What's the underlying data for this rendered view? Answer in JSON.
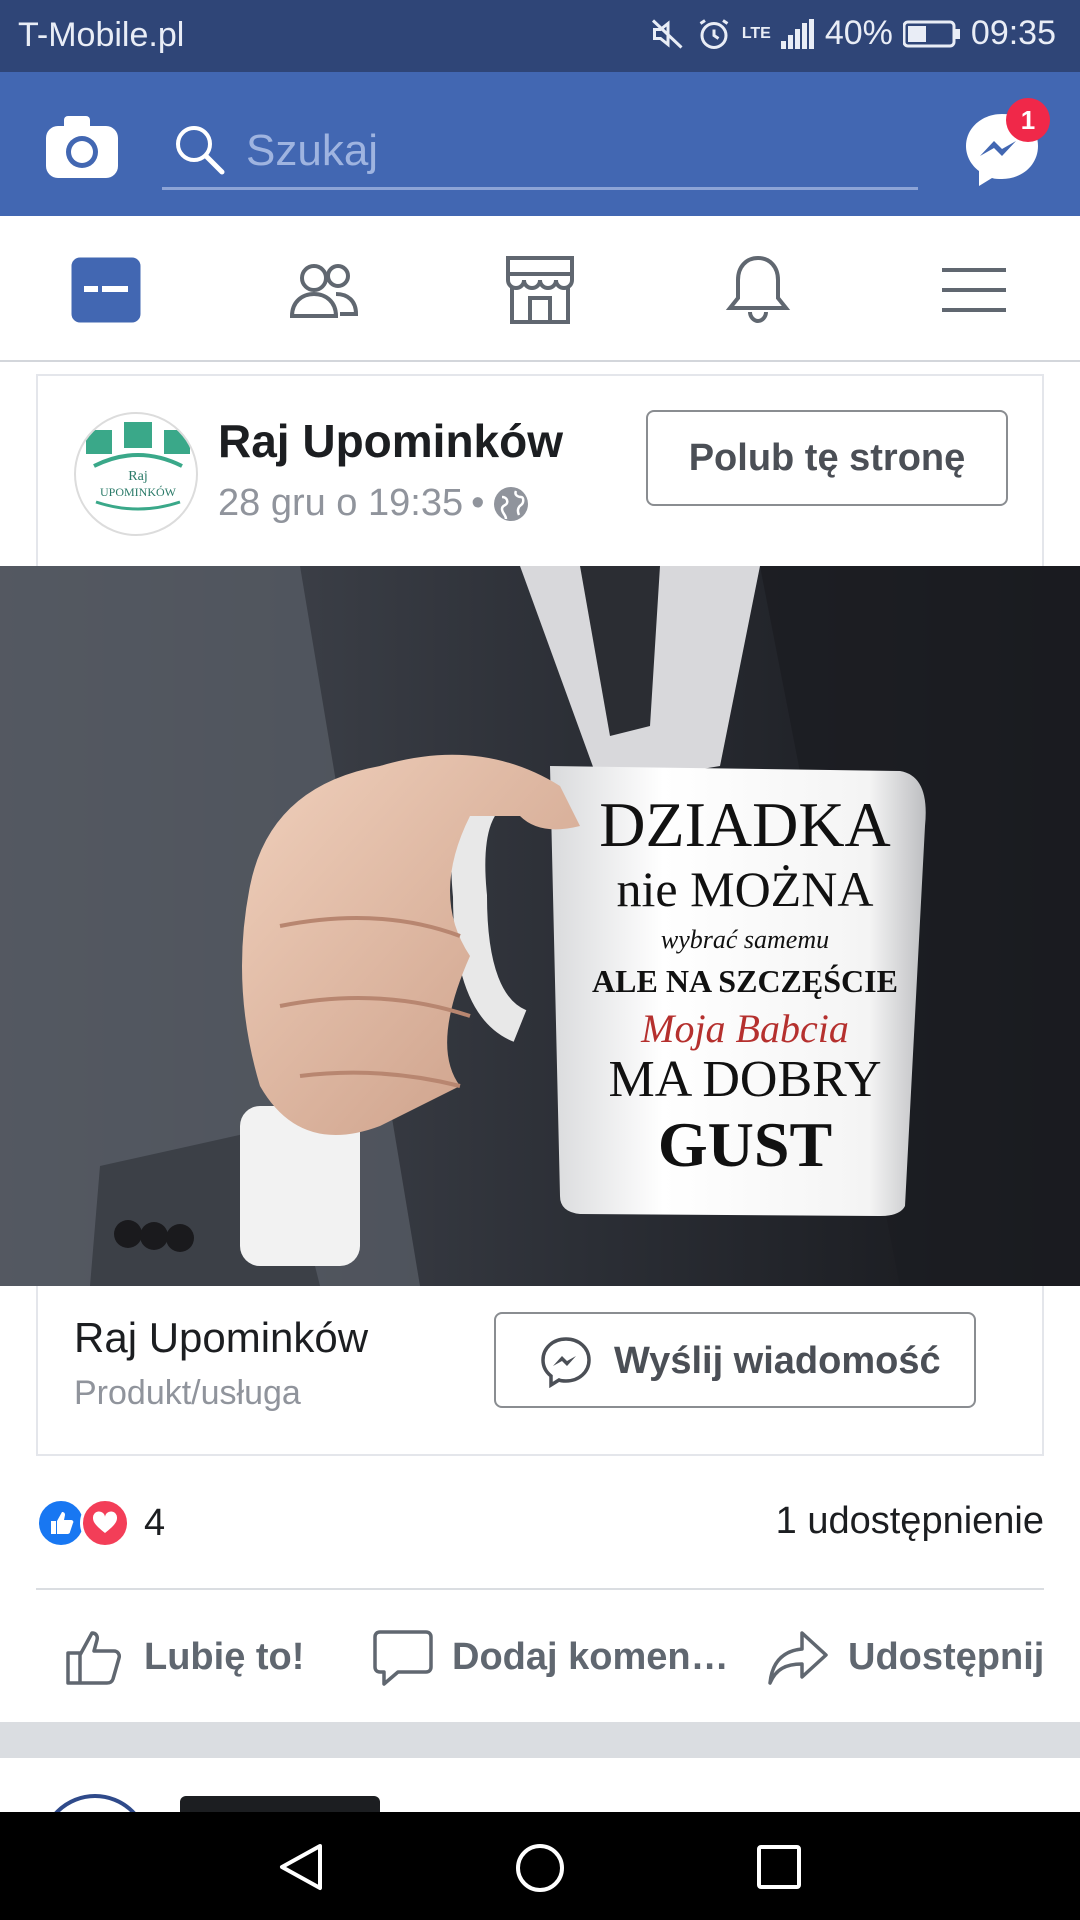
{
  "status_bar": {
    "carrier": "T-Mobile.pl",
    "network": "LTE",
    "battery": "40%",
    "time": "09:35"
  },
  "header": {
    "search_placeholder": "Szukaj",
    "messenger_badge": "1"
  },
  "tabs": [
    "news-feed",
    "friends",
    "marketplace",
    "notifications",
    "menu"
  ],
  "post": {
    "page_name": "Raj Upominków",
    "timestamp": "28 gru o 19:35",
    "separator": "•",
    "like_page_label": "Polub tę stronę",
    "avatar_logo": {
      "line1": "Raj",
      "line2": "UPOMINKÓW"
    },
    "mug_text": [
      "DZIADKA",
      "nie MOŻNA",
      "wybrać samemu",
      "ALE NA SZCZĘŚCIE",
      "Moja Babcia",
      "MA DOBRY",
      "GUST"
    ],
    "attachment": {
      "title": "Raj Upominków",
      "subtitle": "Produkt/usługa",
      "button_label": "Wyślij wiadomość"
    },
    "reaction_count": "4",
    "share_count": "1 udostępnienie",
    "actions": {
      "like": "Lubię to!",
      "comment": "Dodaj komen…",
      "share": "Udostępnij"
    }
  },
  "colors": {
    "brand": "#4267b2",
    "status_bar": "#2f4577",
    "badge": "#f02849"
  }
}
